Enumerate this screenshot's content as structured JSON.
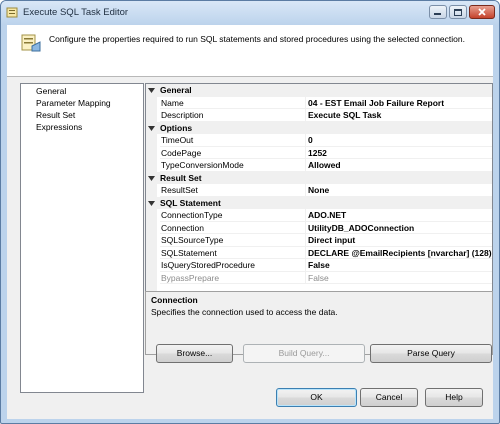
{
  "window": {
    "title": "Execute SQL Task Editor"
  },
  "header": {
    "description": "Configure the properties required to run SQL statements and stored procedures using the selected connection."
  },
  "nav": {
    "items": [
      "General",
      "Parameter Mapping",
      "Result Set",
      "Expressions"
    ]
  },
  "properties": {
    "categories": [
      {
        "label": "General",
        "rows": [
          {
            "name": "Name",
            "value": "04 - EST Email Job Failure Report"
          },
          {
            "name": "Description",
            "value": "Execute SQL Task"
          }
        ]
      },
      {
        "label": "Options",
        "rows": [
          {
            "name": "TimeOut",
            "value": "0"
          },
          {
            "name": "CodePage",
            "value": "1252"
          },
          {
            "name": "TypeConversionMode",
            "value": "Allowed"
          }
        ]
      },
      {
        "label": "Result Set",
        "rows": [
          {
            "name": "ResultSet",
            "value": "None"
          }
        ]
      },
      {
        "label": "SQL Statement",
        "rows": [
          {
            "name": "ConnectionType",
            "value": "ADO.NET"
          },
          {
            "name": "Connection",
            "value": "UtilityDB_ADOConnection"
          },
          {
            "name": "SQLSourceType",
            "value": "Direct input"
          },
          {
            "name": "SQLStatement",
            "value": "DECLARE @EmailRecipients [nvarchar] (128) ="
          },
          {
            "name": "IsQueryStoredProcedure",
            "value": "False"
          },
          {
            "name": "BypassPrepare",
            "value": "False",
            "disabled": true
          }
        ]
      }
    ]
  },
  "description_panel": {
    "title": "Connection",
    "text": "Specifies the connection used to access the data."
  },
  "buttons": {
    "browse": "Browse...",
    "build_query": "Build Query...",
    "parse_query": "Parse Query",
    "ok": "OK",
    "cancel": "Cancel",
    "help": "Help"
  }
}
